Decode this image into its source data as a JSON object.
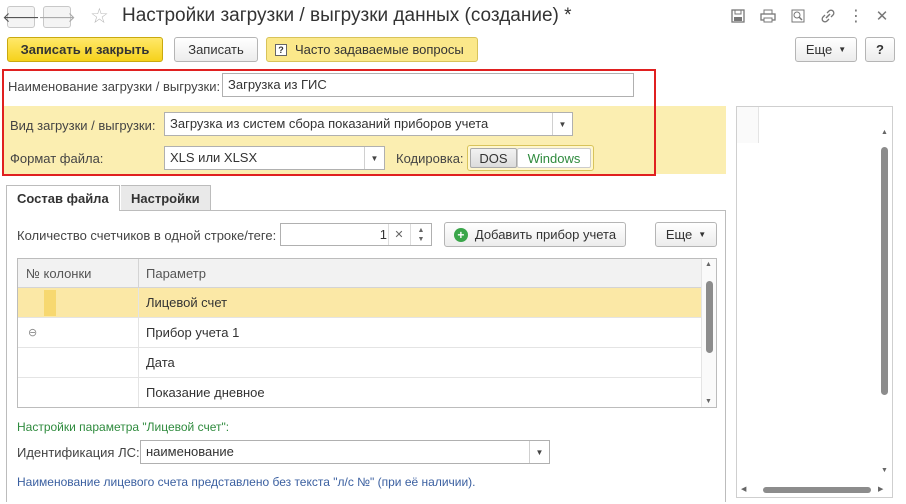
{
  "window": {
    "title": "Настройки загрузки / выгрузки данных (создание) *"
  },
  "toolbar": {
    "save_close_label": "Записать и закрыть",
    "save_label": "Записать",
    "faq_label": "Часто задаваемые вопросы",
    "more_label": "Еще",
    "help_label": "?"
  },
  "form": {
    "name_label": "Наименование загрузки / выгрузки:",
    "name_value": "Загрузка из ГИС",
    "type_label": "Вид загрузки / выгрузки:",
    "type_value": "Загрузка из систем сбора показаний приборов учета",
    "format_label": "Формат файла:",
    "format_value": "XLS или XLSX",
    "encoding_label": "Кодировка:",
    "encoding_options": [
      "DOS",
      "Windows"
    ],
    "encoding_selected": "Windows"
  },
  "tabs": [
    {
      "label": "Состав файла",
      "active": true
    },
    {
      "label": "Настройки",
      "active": false
    }
  ],
  "file_tab": {
    "meters_label": "Количество счетчиков в одной строке/теге:",
    "meters_value": "1",
    "add_meter_label": "Добавить прибор учета",
    "more_label": "Еще",
    "columns": [
      "№ колонки",
      "Параметр"
    ],
    "rows": [
      {
        "col": "",
        "param": "Лицевой счет",
        "selected": true,
        "collapse": false
      },
      {
        "col": "",
        "param": "Прибор учета 1",
        "selected": false,
        "collapse": true
      },
      {
        "col": "",
        "param": "Дата",
        "selected": false,
        "collapse": false
      },
      {
        "col": "",
        "param": "Показание дневное",
        "selected": false,
        "collapse": false
      }
    ],
    "param_settings_title": "Настройки параметра \"Лицевой счет\":",
    "ident_label": "Идентификация ЛС:",
    "ident_value": "наименование",
    "note": "Наименование лицевого счета представлено без текста \"л/с №\" (при её наличии)."
  },
  "colors": {
    "highlight_bg": "#fbeeb1",
    "selected_row": "#fbe8a6",
    "red_border": "#e02020",
    "primary_btn": "#f6d21b"
  }
}
